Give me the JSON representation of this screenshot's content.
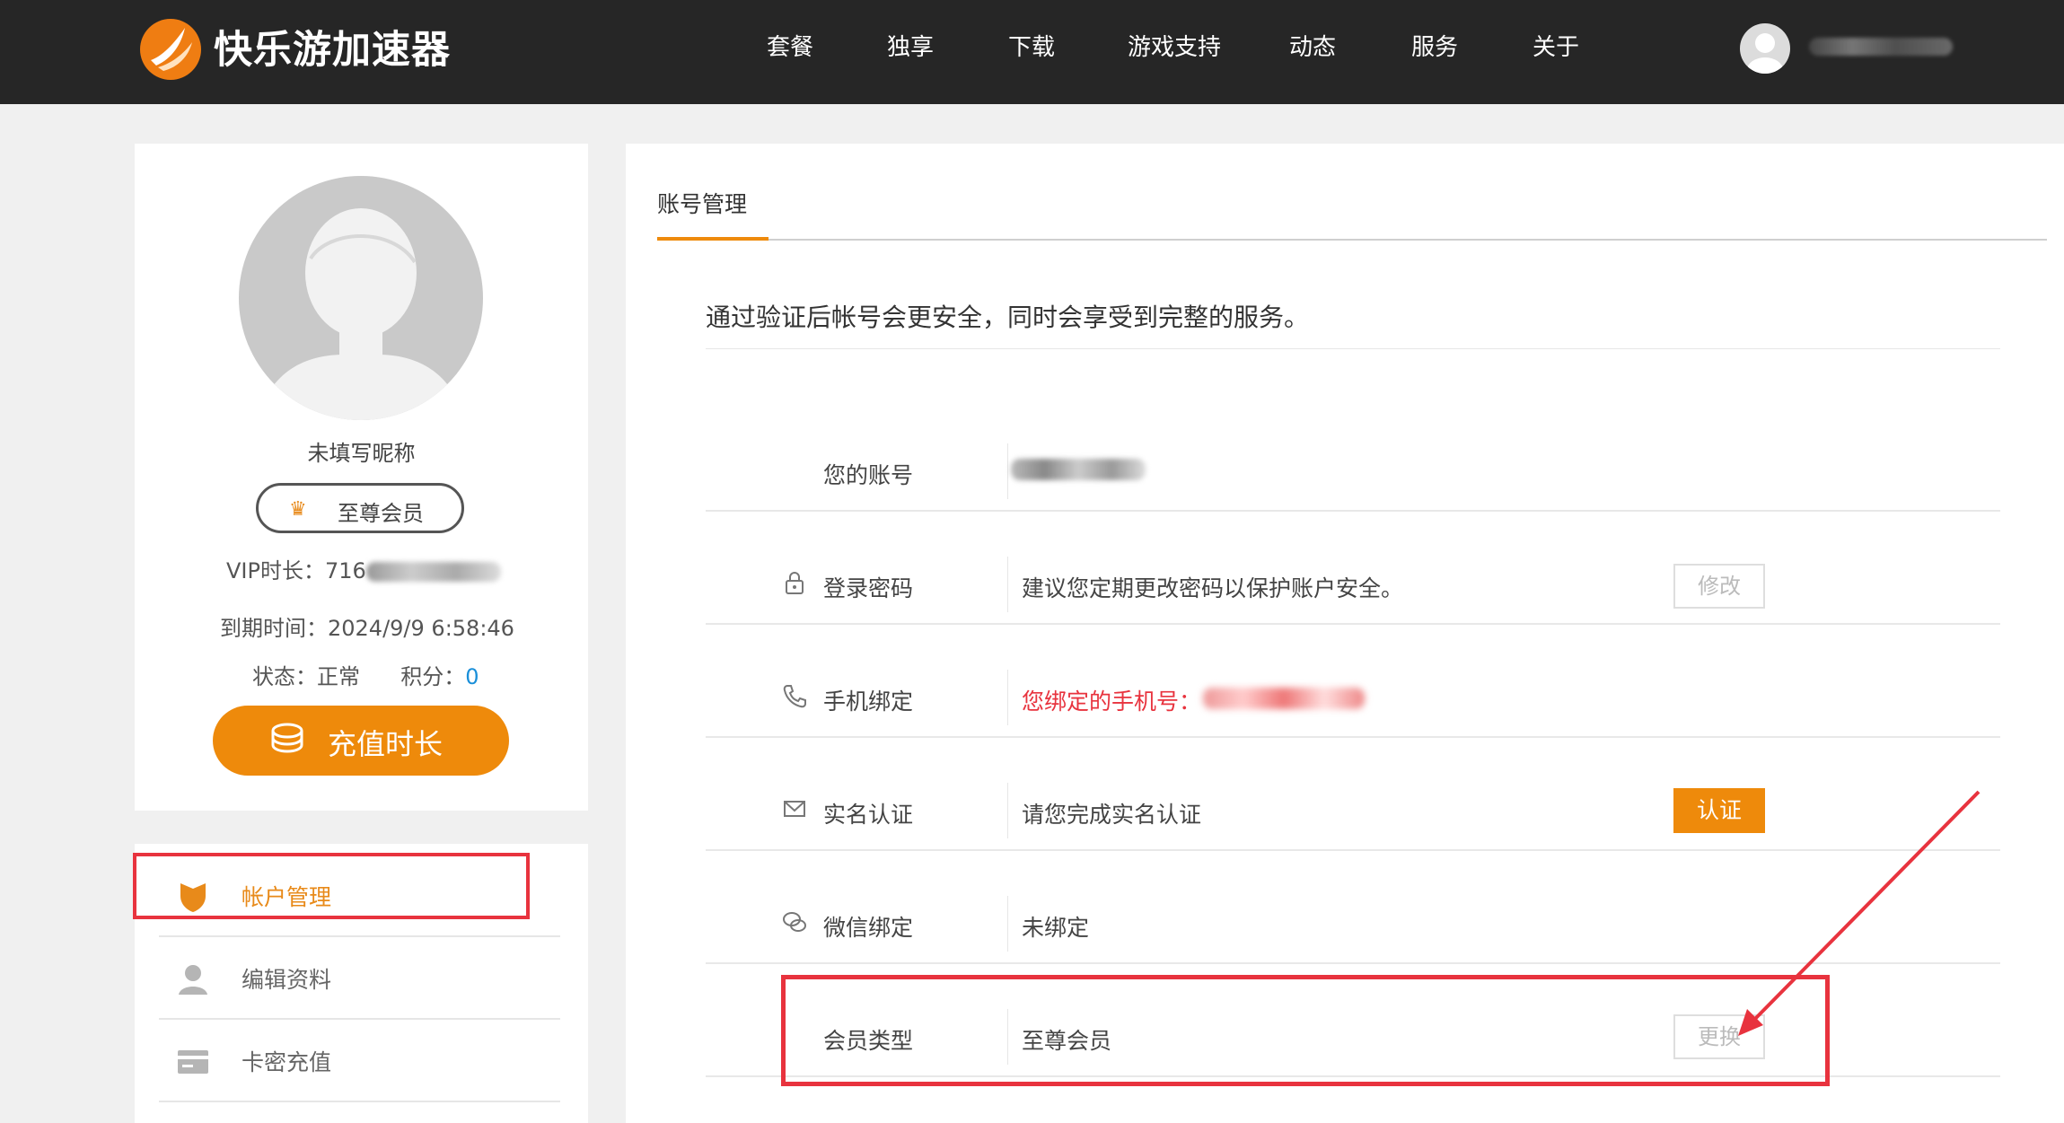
{
  "header": {
    "brand": "快乐游加速器",
    "nav": [
      "套餐",
      "独享",
      "下载",
      "游戏支持",
      "动态",
      "服务",
      "关于"
    ]
  },
  "profile": {
    "nickname": "未填写昵称",
    "vip_badge": "至尊会员",
    "vip_duration_label": "VIP时长：",
    "vip_duration_value": "716",
    "expiry_label": "到期时间：",
    "expiry_value": "2024/9/9 6:58:46",
    "status_label": "状态：",
    "status_value": "正常",
    "points_label": "积分：",
    "points_value": "0",
    "recharge_button": "充值时长"
  },
  "menu": {
    "items": [
      {
        "label": "帐户管理",
        "icon": "shield-icon",
        "active": true
      },
      {
        "label": "编辑资料",
        "icon": "user-icon",
        "active": false
      },
      {
        "label": "卡密充值",
        "icon": "card-icon",
        "active": false
      }
    ]
  },
  "main": {
    "tab": "账号管理",
    "notice": "通过验证后帐号会更安全，同时会享受到完整的服务。",
    "rows": [
      {
        "label": "您的账号",
        "icon": "",
        "value": "",
        "button": ""
      },
      {
        "label": "登录密码",
        "icon": "lock-icon",
        "value": "建议您定期更改密码以保护账户安全。",
        "button": "修改"
      },
      {
        "label": "手机绑定",
        "icon": "phone-icon",
        "value": "您绑定的手机号：",
        "button": ""
      },
      {
        "label": "实名认证",
        "icon": "mail-icon",
        "value": "请您完成实名认证",
        "button": "认证"
      },
      {
        "label": "微信绑定",
        "icon": "wechat-icon",
        "value": "未绑定",
        "button": ""
      },
      {
        "label": "会员类型",
        "icon": "",
        "value": "至尊会员",
        "button": "更换"
      }
    ]
  },
  "colors": {
    "accent": "#ee8a0b",
    "topbar": "#262626",
    "highlight": "#e8333e",
    "link": "#1a8fd9"
  }
}
